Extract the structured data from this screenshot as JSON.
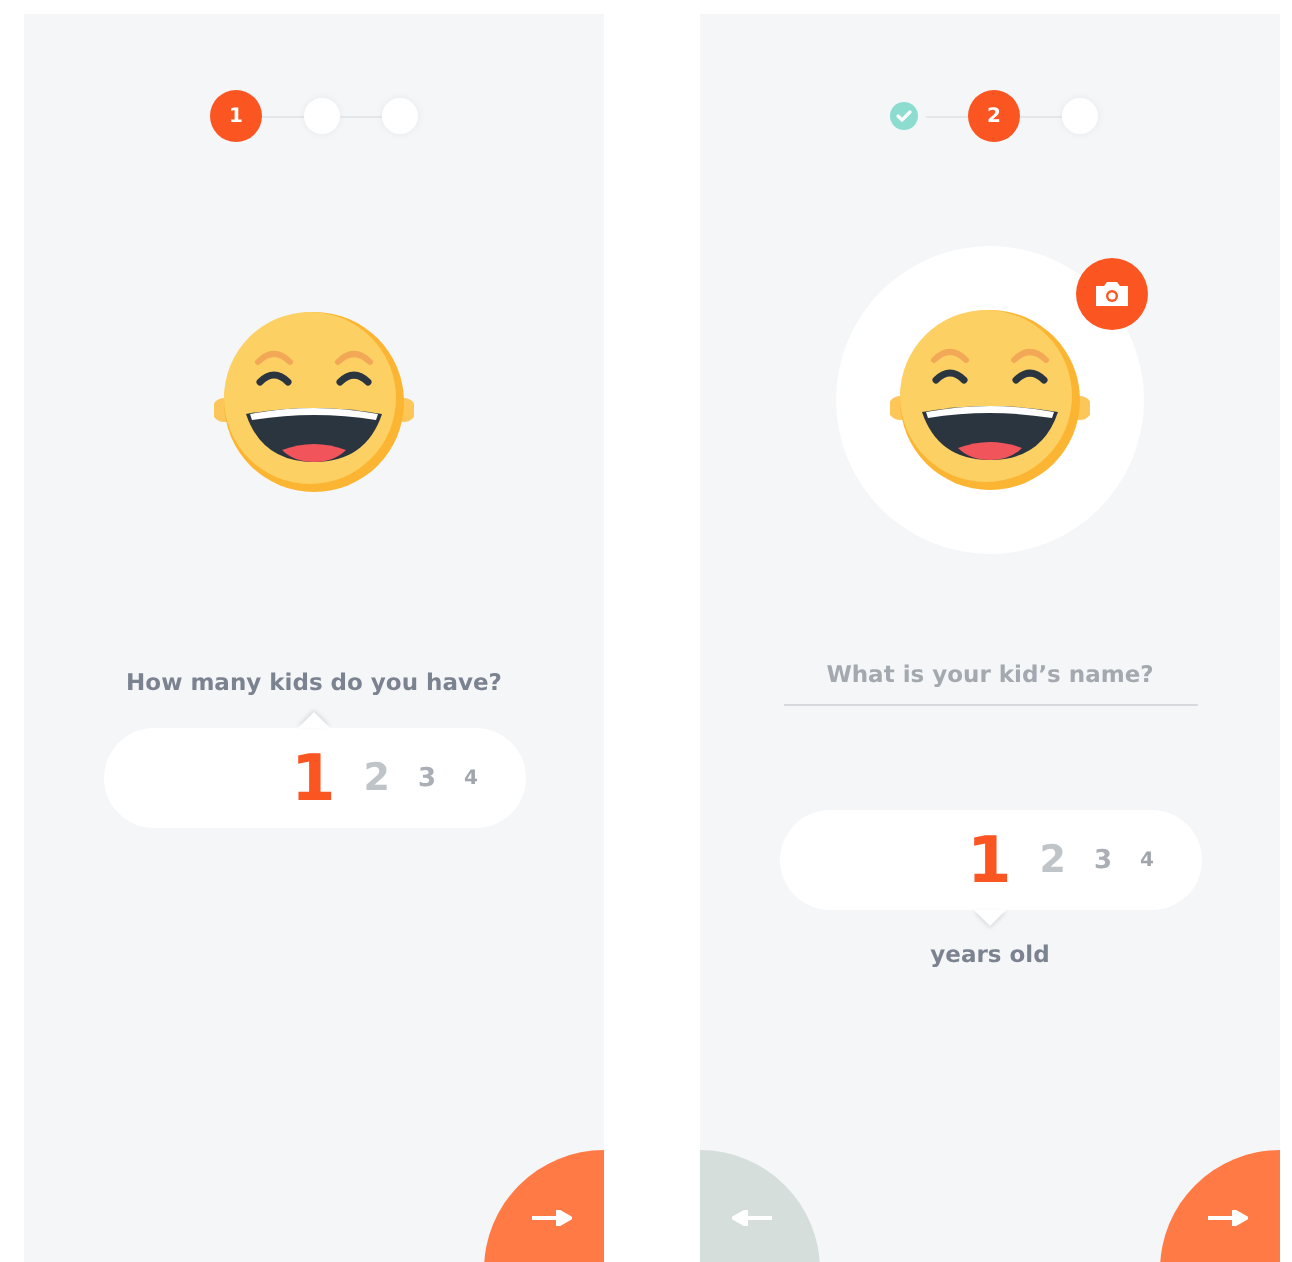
{
  "screens": [
    {
      "kind": "count",
      "steps": [
        {
          "kind": "current",
          "label": "1"
        },
        {
          "kind": "pending"
        },
        {
          "kind": "pending"
        }
      ],
      "question": "How many kids do you have?",
      "picker": {
        "options": [
          {
            "label": "1",
            "selected": true
          },
          {
            "label": "2",
            "selected": false
          },
          {
            "label": "3",
            "selected": false
          },
          {
            "label": "4",
            "selected": false
          }
        ]
      },
      "buttons": [
        {
          "kind": "next"
        }
      ]
    },
    {
      "kind": "profile",
      "steps": [
        {
          "kind": "done"
        },
        {
          "kind": "current",
          "label": "2"
        },
        {
          "kind": "pending"
        }
      ],
      "name_field": {
        "placeholder": "What is your kid’s name?"
      },
      "picker": {
        "options": [
          {
            "label": "1",
            "selected": true
          },
          {
            "label": "2",
            "selected": false
          },
          {
            "label": "3",
            "selected": false
          },
          {
            "label": "4",
            "selected": false
          }
        ]
      },
      "caption": "years old",
      "buttons": [
        {
          "kind": "back"
        },
        {
          "kind": "next"
        }
      ]
    }
  ]
}
